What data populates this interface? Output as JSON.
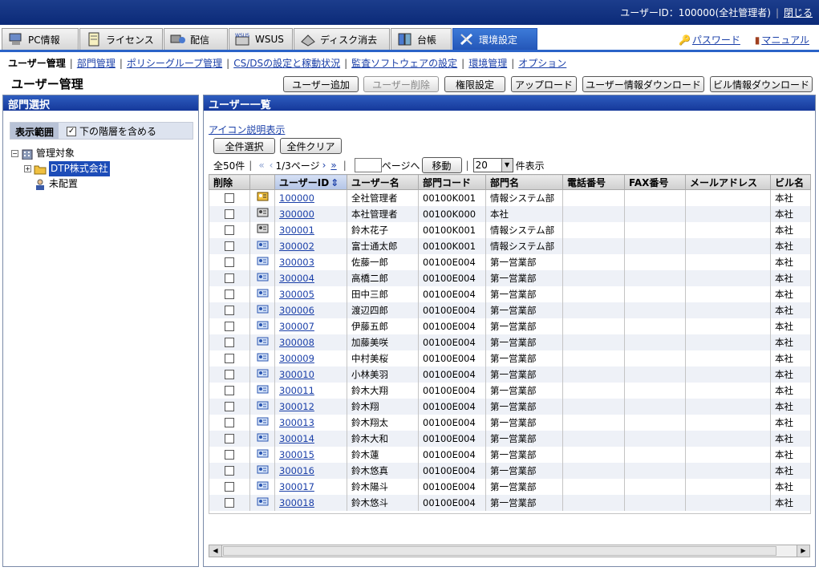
{
  "header": {
    "user_label": "ユーザーID：100000(全社管理者)",
    "logout": "閉じる"
  },
  "tabs": [
    {
      "label": "PC情報",
      "icon": "pc-icon"
    },
    {
      "label": "ライセンス",
      "icon": "license-icon"
    },
    {
      "label": "配信",
      "icon": "delivery-icon"
    },
    {
      "label": "WSUS",
      "icon": "wsus-icon"
    },
    {
      "label": "ディスク消去",
      "icon": "disk-icon"
    },
    {
      "label": "台帳",
      "icon": "ledger-icon"
    },
    {
      "label": "環境設定",
      "icon": "tools-icon",
      "active": true
    }
  ],
  "toplinks": {
    "password": "パスワード",
    "manual": "マニュアル"
  },
  "subnav": [
    "ユーザー管理",
    "部門管理",
    "ポリシーグループ管理",
    "CS/DSの設定と稼動状況",
    "監査ソフトウェアの設定",
    "環境管理",
    "オプション"
  ],
  "page": {
    "title": "ユーザー管理"
  },
  "actions": [
    "ユーザー追加",
    "ユーザー削除",
    "権限設定",
    "アップロード",
    "ユーザー情報ダウンロード",
    "ビル情報ダウンロード"
  ],
  "left": {
    "title": "部門選択",
    "scope_label": "表示範囲",
    "scope_check": "下の階層を含める",
    "tree": [
      "管理対象",
      "DTP株式会社",
      "未配置"
    ]
  },
  "right": {
    "title": "ユーザー一覧",
    "legend_link": "アイコン説明表示",
    "select_all": "全件選択",
    "clear_all": "全件クリア",
    "total": "全50件",
    "page": "1/3ページ",
    "goto_label": "ページへ",
    "move": "移動",
    "per_page": "20",
    "per_page_label": "件表示"
  },
  "columns": [
    "削除",
    "",
    "ユーザーID",
    "ユーザー名",
    "部門コード",
    "部門名",
    "電話番号",
    "FAX番号",
    "メールアドレス",
    "ビル名"
  ],
  "rows": [
    [
      "100000",
      "全社管理者",
      "00100K001",
      "情報システム部",
      "本社",
      "admin-all"
    ],
    [
      "300000",
      "本社管理者",
      "00100K000",
      "本社",
      "本社",
      "admin"
    ],
    [
      "300001",
      "鈴木花子",
      "00100K001",
      "情報システム部",
      "本社",
      "admin"
    ],
    [
      "300002",
      "富士通太郎",
      "00100K001",
      "情報システム部",
      "本社",
      "user"
    ],
    [
      "300003",
      "佐藤一郎",
      "00100E004",
      "第一営業部",
      "本社",
      "user"
    ],
    [
      "300004",
      "高橋二郎",
      "00100E004",
      "第一営業部",
      "本社",
      "user"
    ],
    [
      "300005",
      "田中三郎",
      "00100E004",
      "第一営業部",
      "本社",
      "user"
    ],
    [
      "300006",
      "渡辺四郎",
      "00100E004",
      "第一営業部",
      "本社",
      "user"
    ],
    [
      "300007",
      "伊藤五郎",
      "00100E004",
      "第一営業部",
      "本社",
      "user"
    ],
    [
      "300008",
      "加藤美咲",
      "00100E004",
      "第一営業部",
      "本社",
      "user"
    ],
    [
      "300009",
      "中村美桜",
      "00100E004",
      "第一営業部",
      "本社",
      "user"
    ],
    [
      "300010",
      "小林美羽",
      "00100E004",
      "第一営業部",
      "本社",
      "user"
    ],
    [
      "300011",
      "鈴木大翔",
      "00100E004",
      "第一営業部",
      "本社",
      "user"
    ],
    [
      "300012",
      "鈴木翔",
      "00100E004",
      "第一営業部",
      "本社",
      "user"
    ],
    [
      "300013",
      "鈴木翔太",
      "00100E004",
      "第一営業部",
      "本社",
      "user"
    ],
    [
      "300014",
      "鈴木大和",
      "00100E004",
      "第一営業部",
      "本社",
      "user"
    ],
    [
      "300015",
      "鈴木蓮",
      "00100E004",
      "第一営業部",
      "本社",
      "user"
    ],
    [
      "300016",
      "鈴木悠真",
      "00100E004",
      "第一営業部",
      "本社",
      "user"
    ],
    [
      "300017",
      "鈴木陽斗",
      "00100E004",
      "第一営業部",
      "本社",
      "user"
    ],
    [
      "300018",
      "鈴木悠斗",
      "00100E004",
      "第一営業部",
      "本社",
      "user"
    ]
  ]
}
